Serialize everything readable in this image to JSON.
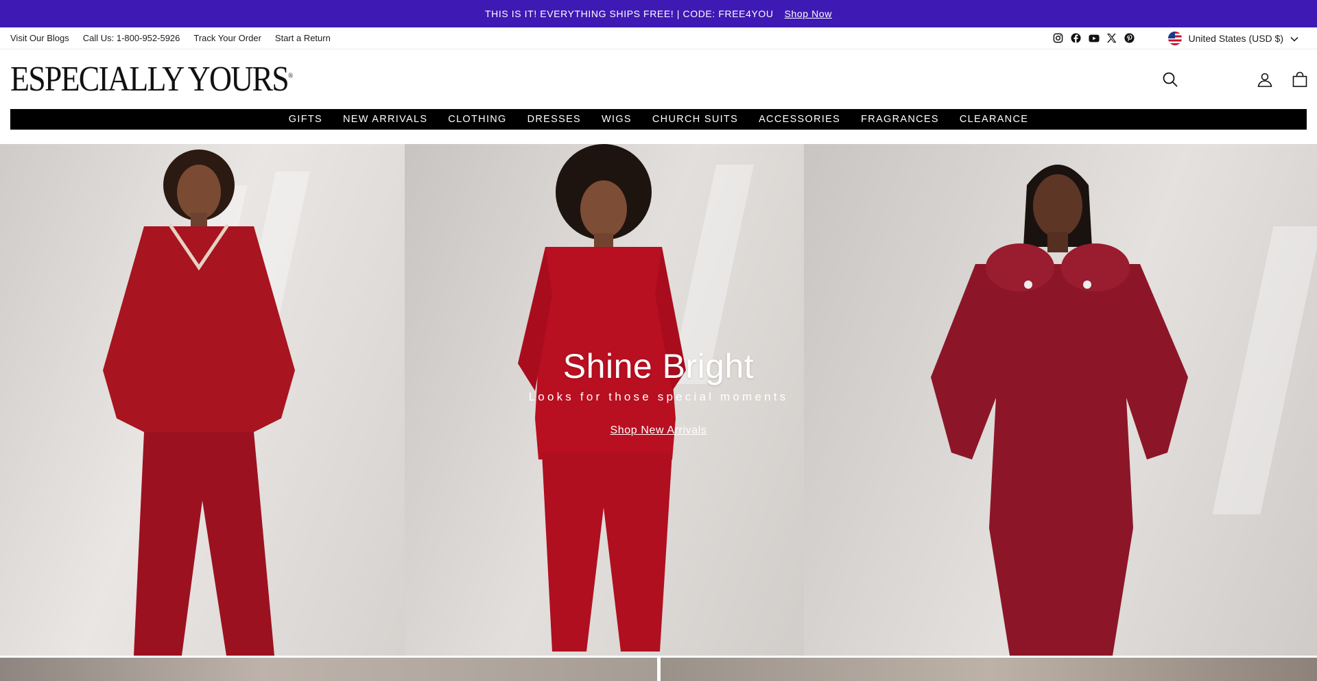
{
  "announcement": {
    "text": "THIS IS IT! EVERYTHING SHIPS FREE! | CODE: FREE4YOU",
    "link": "Shop Now",
    "bg_color": "#3f19b3"
  },
  "utility": {
    "links": [
      "Visit Our Blogs",
      "Call Us: 1-800-952-5926",
      "Track Your Order",
      "Start a Return"
    ],
    "social_icons": [
      "instagram-icon",
      "facebook-icon",
      "youtube-icon",
      "x-icon",
      "pinterest-icon"
    ],
    "country": "United States (USD $)"
  },
  "header": {
    "logo": "ESPECIALLY YOURS",
    "logo_mark": "®",
    "icons": [
      "search-icon",
      "account-icon",
      "cart-icon"
    ]
  },
  "nav": {
    "items": [
      "GIFTS",
      "NEW ARRIVALS",
      "CLOTHING",
      "DRESSES",
      "WIGS",
      "CHURCH SUITS",
      "ACCESSORIES",
      "FRAGRANCES",
      "CLEARANCE"
    ]
  },
  "hero": {
    "title": "Shine Bright",
    "subtitle": "Looks for those special moments",
    "cta": "Shop New Arrivals",
    "accent_color": "#a8141f"
  }
}
